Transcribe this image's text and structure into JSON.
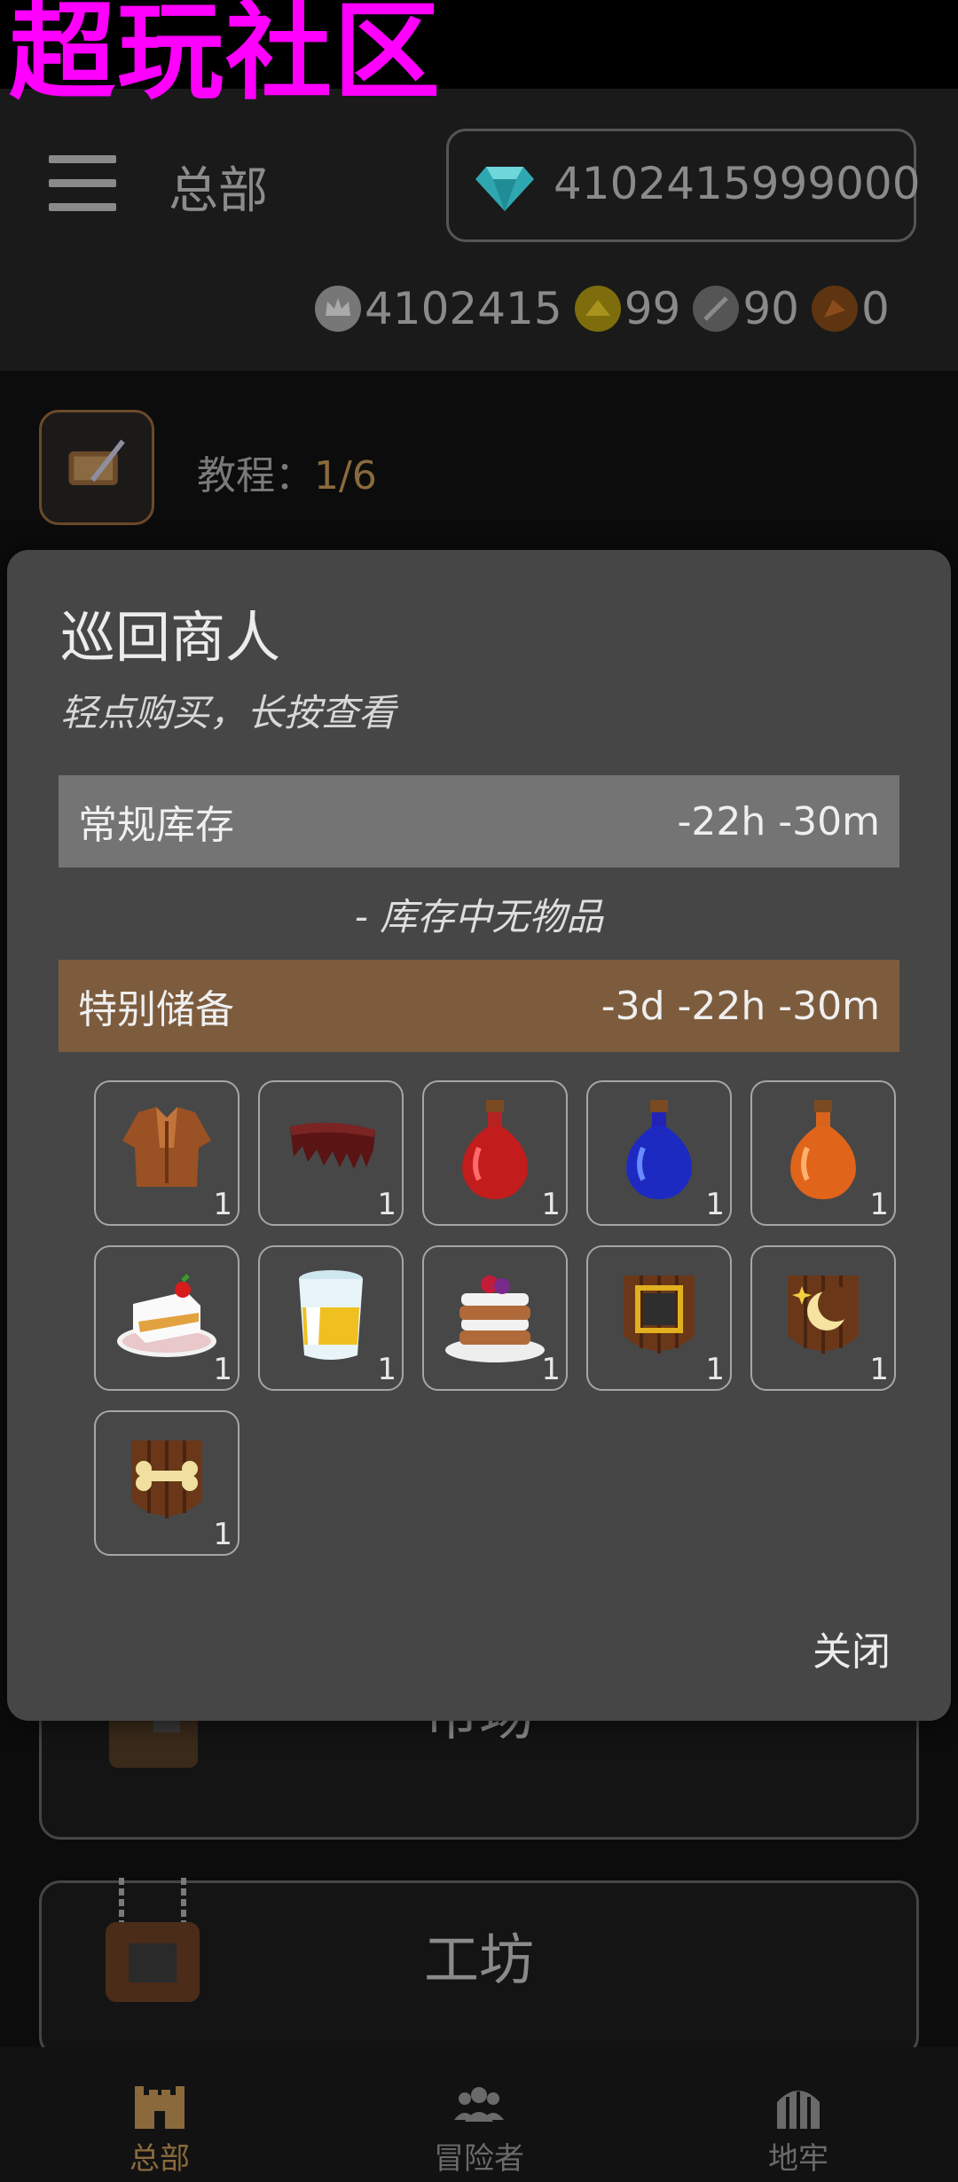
{
  "watermark": "超玩社区",
  "header": {
    "title": "总部",
    "gems": "4102415999000",
    "currencies": [
      {
        "name": "silver-crown",
        "value": "4102415",
        "color": "#7a7a7a"
      },
      {
        "name": "gold-token",
        "value": "99",
        "color": "#8a7a10"
      },
      {
        "name": "sword-token",
        "value": "90",
        "color": "#5c5c5c"
      },
      {
        "name": "bronze-token",
        "value": "0",
        "color": "#6a3c12"
      }
    ]
  },
  "tutorial": {
    "label": "教程：",
    "progress": "1/6"
  },
  "background_cards": {
    "market": "市场",
    "workshop": "工坊"
  },
  "modal": {
    "title": "巡回商人",
    "subtitle": "轻点购买，长按查看",
    "regular_label": "常规库存",
    "regular_timer": "-22h -30m",
    "empty_note": "- 库存中无物品",
    "special_label": "特别储备",
    "special_timer": "-3d -22h -30m",
    "items": [
      {
        "icon": "leather-armor-icon",
        "qty": "1"
      },
      {
        "icon": "dark-cloak-icon",
        "qty": "1"
      },
      {
        "icon": "red-potion-icon",
        "qty": "1"
      },
      {
        "icon": "blue-potion-icon",
        "qty": "1"
      },
      {
        "icon": "orange-potion-icon",
        "qty": "1"
      },
      {
        "icon": "cake-icon",
        "qty": "1"
      },
      {
        "icon": "milk-glass-icon",
        "qty": "1"
      },
      {
        "icon": "pancake-stack-icon",
        "qty": "1"
      },
      {
        "icon": "frame-banner-icon",
        "qty": "1"
      },
      {
        "icon": "moon-banner-icon",
        "qty": "1"
      },
      {
        "icon": "bone-banner-icon",
        "qty": "1"
      }
    ],
    "close_label": "关闭"
  },
  "nav": {
    "hq": "总部",
    "adventurers": "冒险者",
    "dungeon": "地牢",
    "active_color": "#8a6a3c",
    "inactive_color": "#6a6a6a"
  }
}
